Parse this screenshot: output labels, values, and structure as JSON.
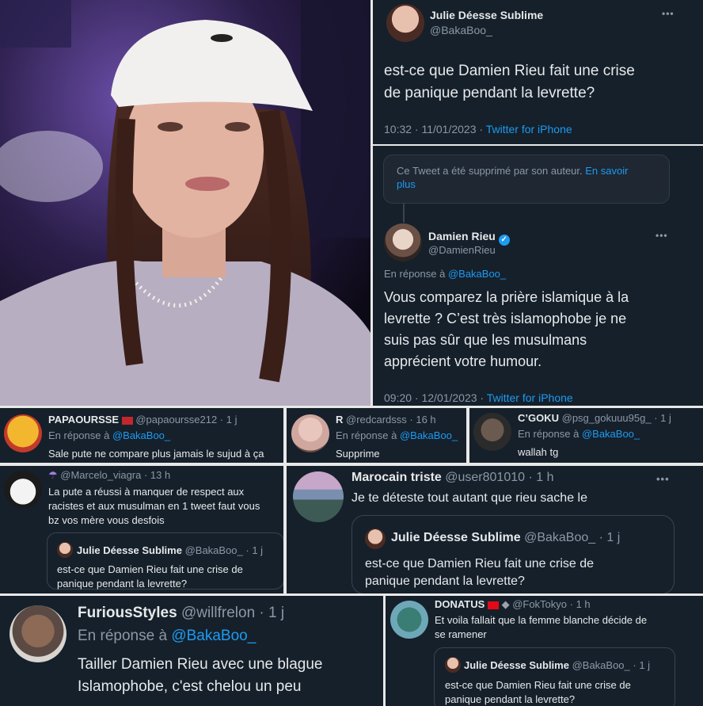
{
  "main_tweet": {
    "name": "Julie Déesse Sublime",
    "handle": "@BakaBoo_",
    "text_line1": "est-ce que Damien Rieu fait une crise",
    "text_line2": "de panique pendant la levrette?",
    "time": "10:32 · 11/01/2023 · ",
    "source": "Twitter for iPhone"
  },
  "deleted_notice": {
    "text": "Ce Tweet a été supprimé par son auteur. ",
    "link_a": "En savoir",
    "link_b": "plus"
  },
  "rieu_tweet": {
    "name": "Damien Rieu",
    "handle": "@DamienRieu",
    "reply_prefix": "En réponse à ",
    "reply_to": "@BakaBoo_",
    "lines": [
      "Vous comparez la prière islamique à la",
      "levrette ? C’est très islamophobe je ne",
      "suis pas sûr que les musulmans",
      "apprécient votre humour."
    ],
    "time": "09:20 · 12/01/2023 · ",
    "source": "Twitter for iPhone"
  },
  "replies": {
    "papa": {
      "name": "PAPAOURSSE",
      "meta": "@papaoursse212 · 1 j",
      "reply_prefix": "En réponse à ",
      "reply_to": "@BakaBoo_",
      "text": "Sale pute ne compare plus jamais le sujud à ça"
    },
    "r": {
      "name": "R",
      "meta": "@redcardsss · 16 h",
      "reply_prefix": "En réponse à ",
      "reply_to": "@BakaBoo_",
      "text": "Supprime"
    },
    "goku": {
      "name": "C’GOKU",
      "meta": "@psg_gokuuu95g_ · 1 j",
      "reply_prefix": "En réponse à ",
      "reply_to": "@BakaBoo_",
      "text": "wallah tg"
    },
    "marcelo": {
      "meta": "@Marcelo_viagra · 13 h",
      "lines": [
        "La pute a réussi à manquer de respect aux",
        "racistes et aux musulman en 1 tweet faut vous",
        "bz vos mère vous desfois"
      ],
      "quote_name": "Julie Déesse Sublime",
      "quote_meta": "@BakaBoo_ · 1 j",
      "quote_line1": "est-ce que Damien Rieu fait une crise de",
      "quote_line2": "panique pendant la levrette?"
    },
    "marocain": {
      "name": "Marocain triste",
      "meta": "@user801010 · 1 h",
      "text": "Je te déteste tout autant que rieu sache le",
      "quote_name": "Julie Déesse Sublime",
      "quote_meta": "@BakaBoo_ · 1 j",
      "quote_line1": "est-ce que Damien Rieu fait une crise de",
      "quote_line2": "panique pendant la levrette?"
    },
    "furious": {
      "name": "FuriousStyles",
      "meta": "@willfrelon · 1 j",
      "reply_prefix": "En réponse à ",
      "reply_to": "@BakaBoo_",
      "line1": "Tailler Damien Rieu avec une blague",
      "line2": "Islamophobe, c'est chelou un peu"
    },
    "donatus": {
      "name": "DONATUS",
      "meta": "@FokTokyo · 1 h",
      "line1": "Et voila fallait que la femme blanche décide de",
      "line2": "se ramener",
      "quote_name": "Julie Déesse Sublime",
      "quote_meta": "@BakaBoo_ · 1 j",
      "quote_line1": "est-ce que Damien Rieu fait une crise de",
      "quote_line2": "panique pendant la levrette?"
    }
  },
  "icons": {
    "more": "•••",
    "verified": "✓"
  },
  "colors": {
    "background": "#15202b",
    "link": "#1d9bf0",
    "muted": "#8b98a5",
    "text": "#e7e9ea"
  }
}
